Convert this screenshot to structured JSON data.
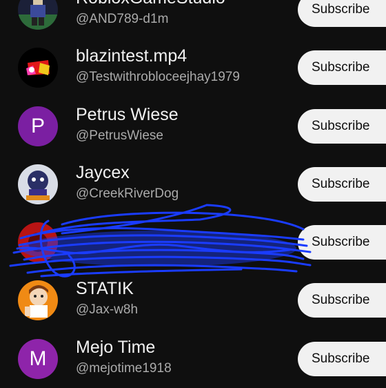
{
  "subscribe_label": "Subscribe",
  "channels": [
    {
      "name": "RobloxGameStudio",
      "handle": "@AND789-d1m",
      "avatar": "image-avatar"
    },
    {
      "name": "blazintest.mp4",
      "handle": "@Testwithrobloceejhay1979",
      "avatar": "image-avatar"
    },
    {
      "name": "Petrus Wiese",
      "handle": "@PetrusWiese",
      "avatar_letter": "P",
      "avatar_color": "#7b1fa2"
    },
    {
      "name": "Jaycex",
      "handle": "@CreekRiverDog",
      "avatar": "image-avatar"
    },
    {
      "name": "",
      "handle": "",
      "avatar": "image-avatar",
      "redacted": true
    },
    {
      "name": "STATIK",
      "handle": "@Jax-w8h",
      "avatar": "image-avatar"
    },
    {
      "name": "Mejo Time",
      "handle": "@mejotime1918",
      "avatar_letter": "M",
      "avatar_color": "#8e24aa"
    }
  ],
  "colors": {
    "background": "#0f0f0f",
    "button_bg": "#f1f1f1",
    "scribble": "#1a3cff"
  }
}
